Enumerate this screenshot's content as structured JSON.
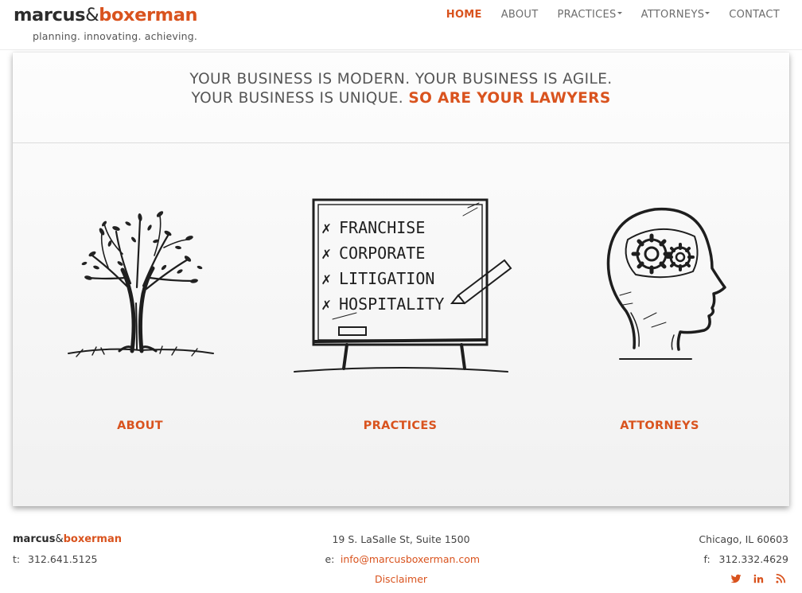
{
  "brand": {
    "name_part1": "marcus",
    "amp": "&",
    "name_part2": "boxerman",
    "tagline": "planning. innovating. achieving."
  },
  "nav": {
    "home": "HOME",
    "about": "ABOUT",
    "practices": "PRACTICES",
    "attorneys": "ATTORNEYS",
    "contact": "CONTACT",
    "active": "HOME"
  },
  "hero": {
    "line1": "YOUR BUSINESS IS MODERN. YOUR BUSINESS IS AGILE.",
    "line2": "YOUR BUSINESS IS UNIQUE.",
    "accent": "SO ARE YOUR LAWYERS"
  },
  "features": {
    "about": {
      "label": "ABOUT",
      "icon": "tree-sketch-icon"
    },
    "practices": {
      "label": "PRACTICES",
      "icon": "whiteboard-sketch-icon",
      "board_items": [
        "FRANCHISE",
        "CORPORATE",
        "LITIGATION",
        "HOSPITALITY"
      ]
    },
    "attorneys": {
      "label": "ATTORNEYS",
      "icon": "head-gears-sketch-icon"
    }
  },
  "footer": {
    "address": "19 S. LaSalle St, Suite 1500",
    "city": "Chicago, IL 60603",
    "phone_label": "t:",
    "phone": "312.641.5125",
    "email_label": "e:",
    "email": "info@marcusboxerman.com",
    "fax_label": "f:",
    "fax": "312.332.4629",
    "disclaimer": "Disclaimer",
    "social": [
      "twitter-icon",
      "linkedin-icon",
      "rss-icon"
    ]
  },
  "colors": {
    "accent": "#d9531e",
    "text": "#444444",
    "nav_text": "#6d6d6d"
  }
}
